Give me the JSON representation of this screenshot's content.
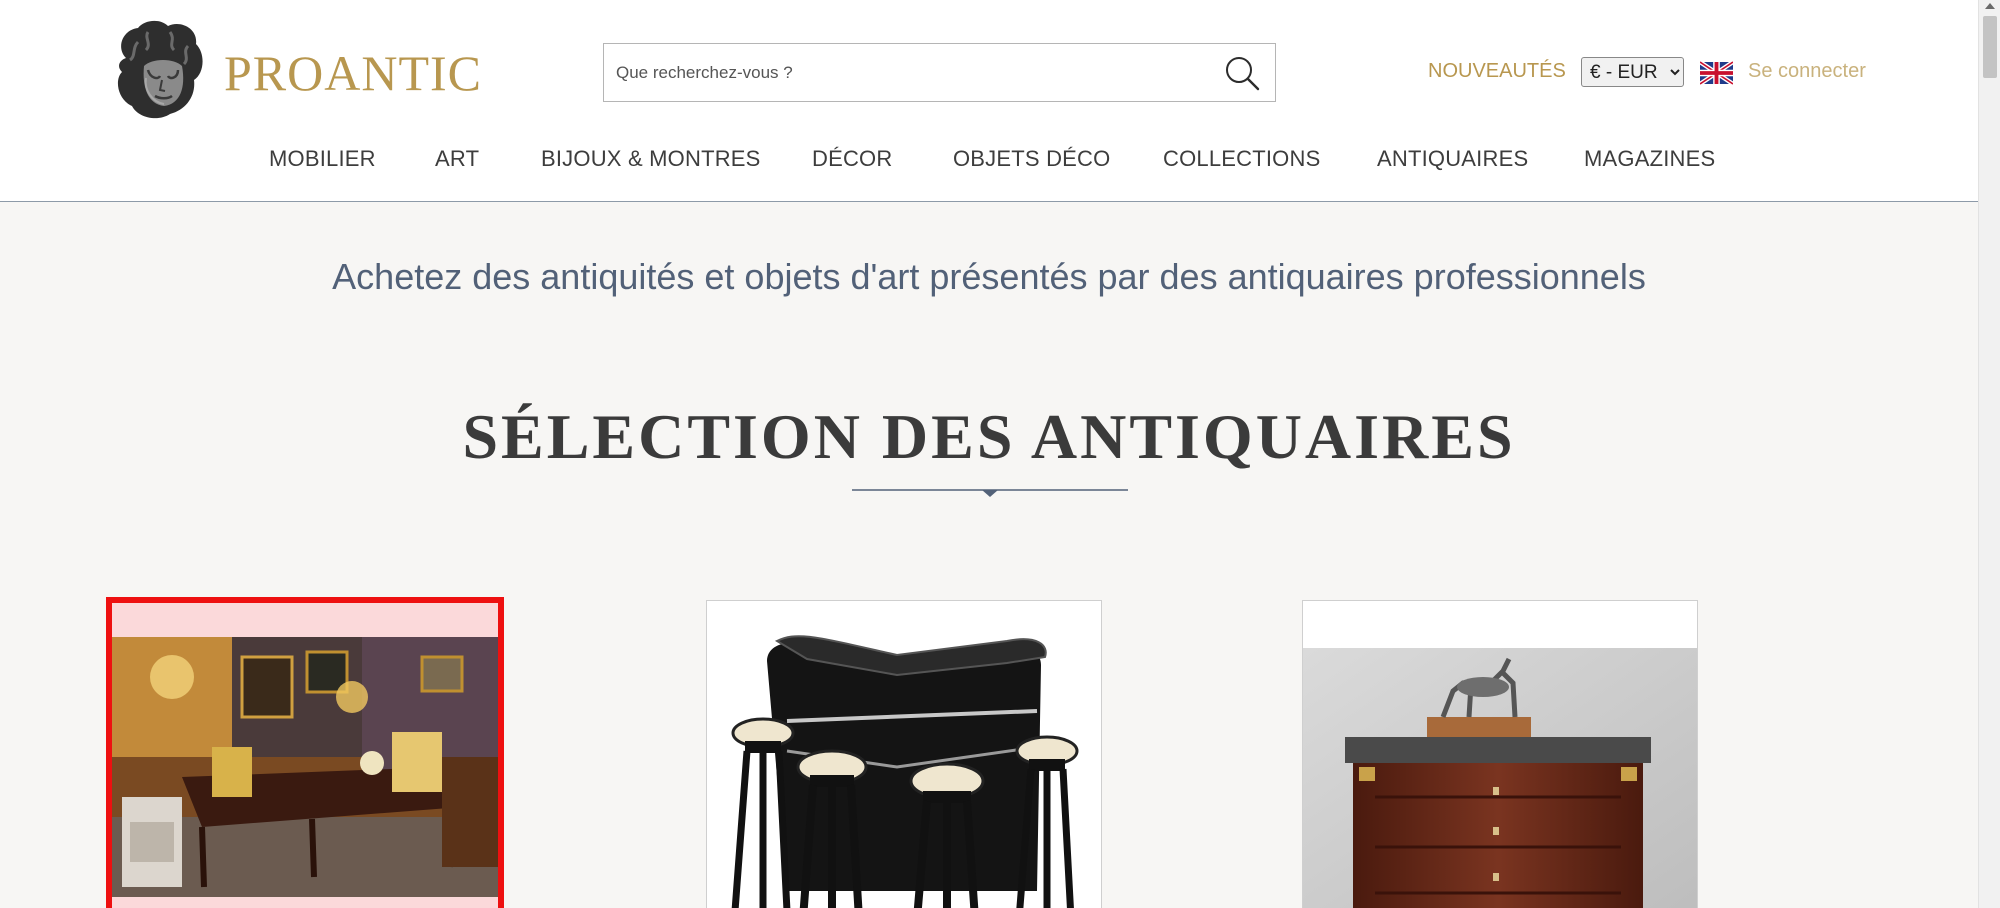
{
  "header": {
    "brand": "PROANTIC",
    "logo_icon": "sculpture-head-logo-icon",
    "search": {
      "placeholder": "Que recherchez-vous ?",
      "value": "",
      "icon": "search-icon"
    },
    "nouveautes_label": "NOUVEAUTÉS",
    "currency": {
      "selected": "€ - EUR"
    },
    "language_icon": "uk-flag-icon",
    "login_label": "Se connecter"
  },
  "nav": {
    "items": [
      {
        "label": "MOBILIER"
      },
      {
        "label": "ART"
      },
      {
        "label": "BIJOUX & MONTRES"
      },
      {
        "label": "DÉCOR"
      },
      {
        "label": "OBJETS DÉCO"
      },
      {
        "label": "COLLECTIONS"
      },
      {
        "label": "ANTIQUAIRES"
      },
      {
        "label": "MAGAZINES"
      }
    ]
  },
  "main": {
    "tagline": "Achetez des antiquités et objets d'art présentés par des antiquaires professionnels",
    "section_title": "SÉLECTION DES ANTIQUAIRES",
    "cards": [
      {
        "image": "antique-showroom-image",
        "selected": true
      },
      {
        "image": "art-deco-bar-with-stools-image"
      },
      {
        "image": "empire-commode-with-deer-sculpture-image"
      }
    ]
  },
  "colors": {
    "brand_gold": "#b8974f",
    "tagline_blue": "#526178",
    "highlight_red": "#ee1010",
    "page_background": "#f7f6f4"
  }
}
